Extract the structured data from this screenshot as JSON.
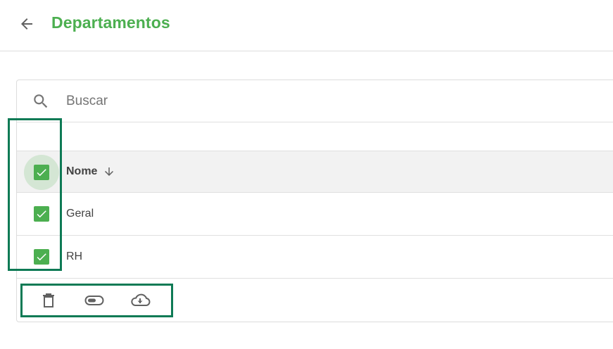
{
  "header": {
    "title": "Departamentos",
    "back_icon": "arrow-left-icon",
    "title_color": "#4caf50"
  },
  "search": {
    "placeholder": "Buscar",
    "value": "",
    "icon": "search-icon"
  },
  "table": {
    "columns": [
      {
        "label": "Nome",
        "sort": "descending",
        "sort_icon": "arrow-down-icon"
      }
    ],
    "select_all_checked": true,
    "rows": [
      {
        "name": "Geral",
        "checked": true
      },
      {
        "name": "RH",
        "checked": true
      }
    ]
  },
  "bulk_actions": [
    {
      "name": "delete",
      "icon": "trash-icon"
    },
    {
      "name": "toggle-status",
      "icon": "toggle-icon"
    },
    {
      "name": "download",
      "icon": "cloud-download-icon"
    }
  ],
  "colors": {
    "accent": "#4caf50",
    "highlight_border": "#0e7a55",
    "header_bg": "#f2f2f2",
    "divider": "#e0e0e0"
  }
}
